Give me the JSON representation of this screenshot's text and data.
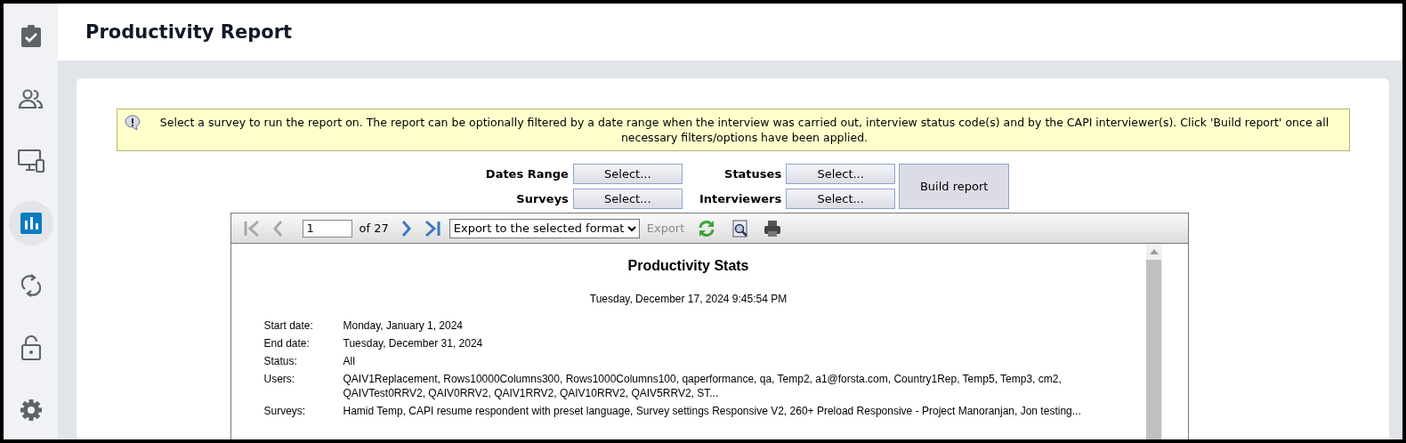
{
  "sidebar": {
    "items": [
      {
        "selected": false
      },
      {
        "selected": false
      },
      {
        "selected": false
      },
      {
        "selected": true
      },
      {
        "selected": false
      },
      {
        "selected": false
      },
      {
        "selected": false
      }
    ]
  },
  "header": {
    "title": "Productivity Report"
  },
  "info_banner": {
    "text": "Select a survey to run the report on. The report can be optionally filtered by a date range when the interview was carried out, interview status code(s) and by the CAPI interviewer(s). Click 'Build report' once all necessary filters/options have been applied."
  },
  "filters": [
    {
      "label": "Dates Range",
      "button": "Select..."
    },
    {
      "label": "Statuses",
      "button": "Select..."
    },
    {
      "label": "Surveys",
      "button": "Select..."
    },
    {
      "label": "Interviewers",
      "button": "Select..."
    }
  ],
  "build_button": "Build report",
  "toolbar": {
    "first_disabled": true,
    "prev_disabled": true,
    "page": "1",
    "page_count": "of 27",
    "next_disabled": false,
    "last_disabled": false,
    "export_format": "Export to the selected format",
    "export_button": "Export",
    "export_disabled": true
  },
  "report": {
    "title": "Productivity Stats",
    "timestamp": "Tuesday, December 17, 2024 9:45:54 PM",
    "fields": [
      {
        "label": "Start date:",
        "value": "Monday, January 1, 2024"
      },
      {
        "label": "End date:",
        "value": "Tuesday, December 31, 2024"
      },
      {
        "label": "Status:",
        "value": "All"
      },
      {
        "label": "Users:",
        "value": "QAIV1Replacement, Rows10000Columns300, Rows1000Columns100, qaperformance, qa, Temp2, a1@forsta.com, Country1Rep, Temp5, Temp3, cm2, QAIVTest0RRV2, QAIV0RRV2, QAIV1RRV2, QAIV10RRV2, QAIV5RRV2, ST..."
      },
      {
        "label": "Surveys:",
        "value": "Hamid Temp, CAPI resume respondent with preset language, Survey settings Responsive V2, 260+ Preload Responsive - Project Manoranjan, Jon testing..."
      }
    ]
  }
}
